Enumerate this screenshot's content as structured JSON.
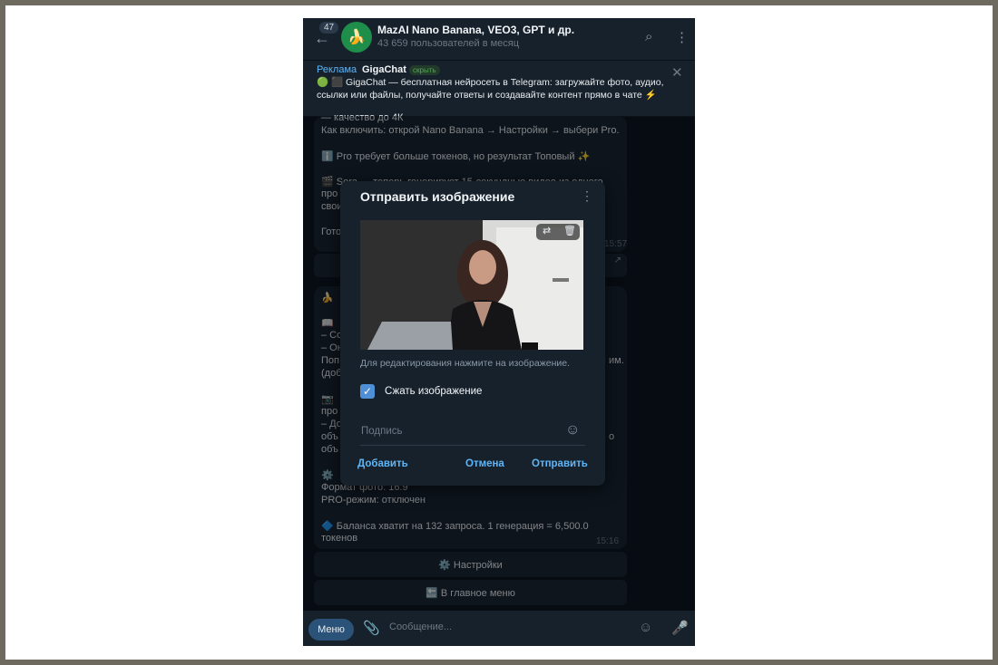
{
  "header": {
    "unread_count": "47",
    "title": "MazAI Nano Banana, VEO3, GPT и др.",
    "subtitle": "43 659 пользователей в месяц"
  },
  "ad": {
    "label": "Реклама",
    "name": "GigaChat",
    "hide": "скрыть",
    "text": "🟢 ⬛ GigaChat — бесплатная нейросеть в Telegram: загружайте фото, аудио, ссылки или файлы, получайте ответы и создавайте контент прямо в чате ⚡"
  },
  "message1": {
    "lines": [
      "— качество до 4К",
      "Как включить: открой Nano Banana → Настройки → выбери Pro.",
      "ℹ️ Pro требует больше токенов, но результат Топовый ✨",
      "🎬 Sora — теперь генерирует 15-секундные видео из одного",
      "про",
      "свои",
      "Гото"
    ],
    "time": "15:57"
  },
  "message2": {
    "lines": [
      "🍌",
      "📖",
      "– Со",
      "– Он",
      "Поп",
      "(доб",
      "📷",
      "про",
      "– До",
      "объ",
      "объ",
      "⚙️",
      "Формат фото: 16:9",
      "PRO-режим: отключен",
      "🔷 Баланса хватит на 132 запроса. 1 генерация = 6,500.0",
      "токенов"
    ],
    "right_fragments": [
      "им.",
      "о"
    ],
    "time": "15:16"
  },
  "keyboard": {
    "settings": "⚙️ Настройки",
    "main_menu": "🔙 В главное меню"
  },
  "input": {
    "menu": "Меню",
    "placeholder": "Сообщение..."
  },
  "dialog": {
    "title": "Отправить изображение",
    "hint": "Для редактирования нажмите на изображение.",
    "compress_label": "Сжать изображение",
    "compress_checked": true,
    "caption_placeholder": "Подпись",
    "add": "Добавить",
    "cancel": "Отмена",
    "send": "Отправить"
  }
}
